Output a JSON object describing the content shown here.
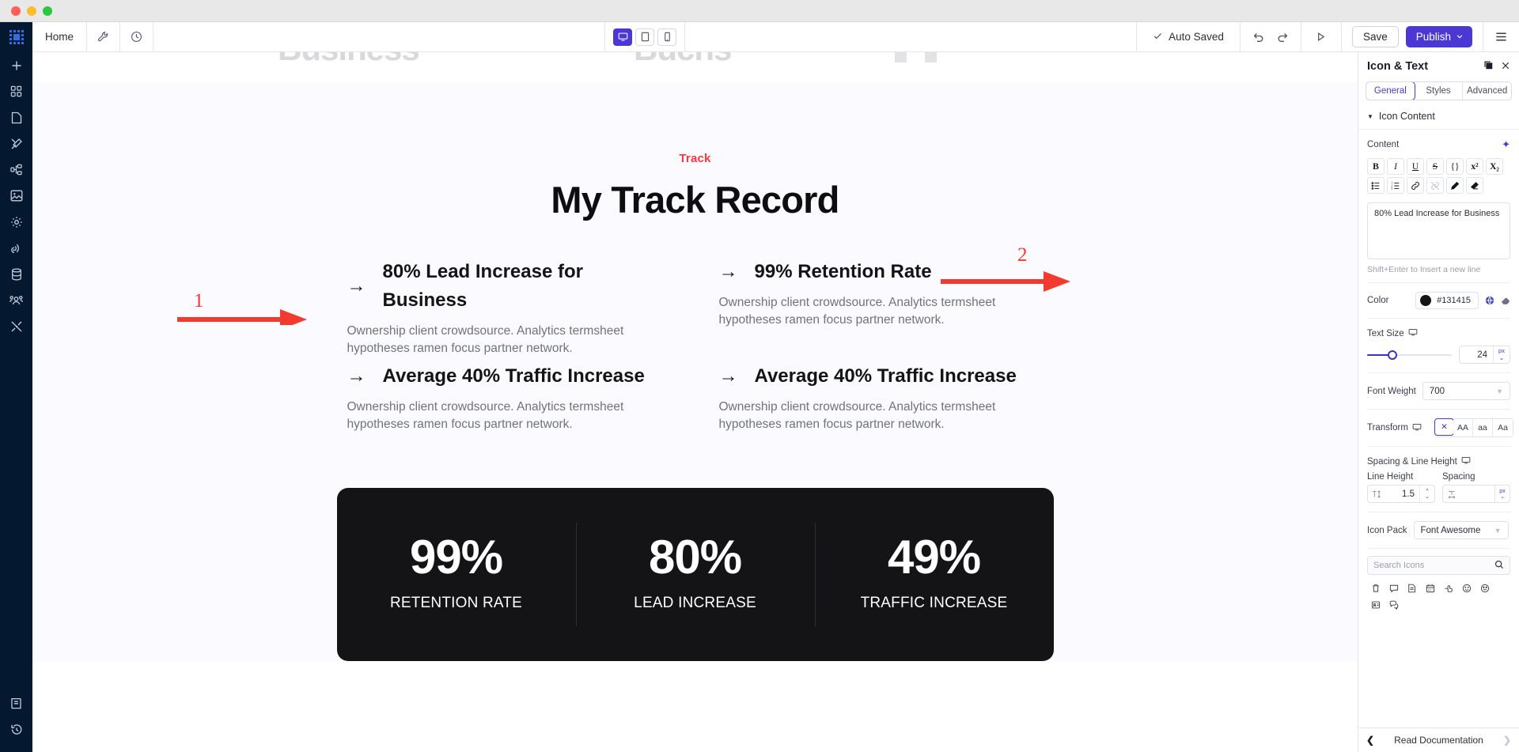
{
  "window": {
    "traffic_lights": [
      "close",
      "minimize",
      "maximize"
    ]
  },
  "rail": {
    "logo_name": "app-grid-logo",
    "items": [
      {
        "name": "add",
        "icon": "plus-icon"
      },
      {
        "name": "templates",
        "icon": "grid-blocks-icon"
      },
      {
        "name": "pages",
        "icon": "page-icon"
      },
      {
        "name": "design",
        "icon": "brush-icon"
      },
      {
        "name": "structure",
        "icon": "sitemap-icon"
      },
      {
        "name": "media",
        "icon": "image-icon"
      },
      {
        "name": "settings",
        "icon": "gear-icon"
      },
      {
        "name": "integrations",
        "icon": "signal-icon"
      },
      {
        "name": "database",
        "icon": "database-icon"
      },
      {
        "name": "users",
        "icon": "users-icon"
      },
      {
        "name": "tools",
        "icon": "tools-icon"
      }
    ],
    "bottom_items": [
      {
        "name": "docs",
        "icon": "book-icon"
      },
      {
        "name": "history",
        "icon": "revert-clock-icon"
      }
    ]
  },
  "toolbar": {
    "home_label": "Home",
    "wrench_icon": "wrench-icon",
    "history_icon": "clock-icon",
    "devices": [
      {
        "name": "desktop",
        "icon": "desktop-icon",
        "active": true
      },
      {
        "name": "tablet",
        "icon": "tablet-icon",
        "active": false
      },
      {
        "name": "mobile",
        "icon": "mobile-icon",
        "active": false
      }
    ],
    "autosave_label": "Auto Saved",
    "autosave_icon": "check-icon",
    "undo_icon": "undo-icon",
    "redo_icon": "redo-icon",
    "preview_icon": "play-icon",
    "save_label": "Save",
    "publish_label": "Publish",
    "publish_caret": "⌄",
    "menu_icon": "hamburger-icon"
  },
  "canvas": {
    "prev_section_text": "Bucns",
    "section": {
      "eyebrow": "Track",
      "heading": "My Track Record",
      "features": [
        {
          "arrow": "→",
          "title": "80% Lead Increase for Business",
          "body": "Ownership client crowdsource. Analytics termsheet hypotheses ramen focus partner network."
        },
        {
          "arrow": "→",
          "title": "99% Retention Rate",
          "body": "Ownership client crowdsource. Analytics termsheet hypotheses ramen focus partner network."
        },
        {
          "arrow": "→",
          "title": "Average 40% Traffic Increase",
          "body": "Ownership client crowdsource. Analytics termsheet hypotheses ramen focus partner network."
        },
        {
          "arrow": "→",
          "title": "Average 40% Traffic Increase",
          "body": "Ownership client crowdsource. Analytics termsheet hypotheses ramen focus partner network."
        }
      ],
      "stats": [
        {
          "value": "99%",
          "label": "RETENTION RATE"
        },
        {
          "value": "80%",
          "label": "LEAD INCREASE"
        },
        {
          "value": "49%",
          "label": "TRAFFIC INCREASE"
        }
      ]
    },
    "annotations": [
      {
        "number": "1",
        "color": "#f4392f"
      },
      {
        "number": "2",
        "color": "#f4392f"
      }
    ]
  },
  "panel": {
    "title": "Icon & Text",
    "duplicate_icon": "duplicate-icon",
    "close_icon": "close-icon",
    "tabs": [
      {
        "label": "General",
        "active": true
      },
      {
        "label": "Styles",
        "active": false
      },
      {
        "label": "Advanced",
        "active": false
      }
    ],
    "accordion_label": "Icon Content",
    "content": {
      "label": "Content",
      "ai_icon": "ai-sparkle-icon",
      "rte_row1": [
        {
          "glyph": "B",
          "name": "bold-button",
          "dim": false
        },
        {
          "glyph": "I",
          "name": "italic-button",
          "dim": false
        },
        {
          "glyph": "U",
          "name": "underline-button",
          "dim": false
        },
        {
          "glyph": "S",
          "name": "strikethrough-button",
          "dim": false
        },
        {
          "glyph": "{}",
          "name": "code-button",
          "dim": false
        },
        {
          "glyph": "x²",
          "name": "superscript-button",
          "dim": false
        },
        {
          "glyph": "X₂",
          "name": "subscript-button",
          "dim": false
        }
      ],
      "rte_row2": [
        {
          "glyph": "☰",
          "name": "bullet-list-button",
          "dim": false
        },
        {
          "glyph": "☰",
          "name": "numbered-list-button",
          "dim": false
        },
        {
          "glyph": "🔗",
          "name": "link-button",
          "dim": false
        },
        {
          "glyph": "🔗",
          "name": "unlink-button",
          "dim": true
        },
        {
          "glyph": "✎",
          "name": "highlight-button",
          "dim": false
        },
        {
          "glyph": "⌫",
          "name": "clear-format-button",
          "dim": false
        }
      ],
      "textarea_value": "80% Lead Increase for Business",
      "hint": "Shift+Enter to Insert a new line"
    },
    "color": {
      "label": "Color",
      "value": "#131415",
      "swatch": "#131415",
      "global_icon": "globe-icon",
      "reset_icon": "eraser-icon"
    },
    "text_size": {
      "label": "Text Size",
      "device_icon": "desktop-icon",
      "value": "24",
      "unit": "px",
      "slider_percent": 25
    },
    "font_weight": {
      "label": "Font Weight",
      "value": "700"
    },
    "transform": {
      "label": "Transform",
      "device_icon": "desktop-icon",
      "options": [
        {
          "glyph": "✕",
          "name": "transform-none",
          "active": true
        },
        {
          "glyph": "AA",
          "name": "transform-uppercase",
          "active": false
        },
        {
          "glyph": "aa",
          "name": "transform-lowercase",
          "active": false
        },
        {
          "glyph": "Aa",
          "name": "transform-capitalize",
          "active": false
        }
      ]
    },
    "spacing": {
      "group_label": "Spacing & Line Height",
      "device_icon": "desktop-icon",
      "line_height_label": "Line Height",
      "line_height_value": "1.5",
      "line_height_unit": "",
      "spacing_label": "Spacing",
      "spacing_value": "",
      "spacing_unit": "px"
    },
    "icon_pack": {
      "label": "Icon Pack",
      "value": "Font Awesome"
    },
    "search": {
      "placeholder": "Search Icons",
      "icon": "search-icon"
    },
    "icon_results": [
      "trash-icon",
      "comment-icon",
      "file-icon",
      "calendar-icon",
      "hand-pointer-icon",
      "smile-icon",
      "meh-icon",
      "address-card-icon",
      "comments-icon"
    ],
    "footer": {
      "prev_icon": "chevron-left-icon",
      "label": "Read Documentation",
      "next_icon": "chevron-right-icon"
    }
  }
}
